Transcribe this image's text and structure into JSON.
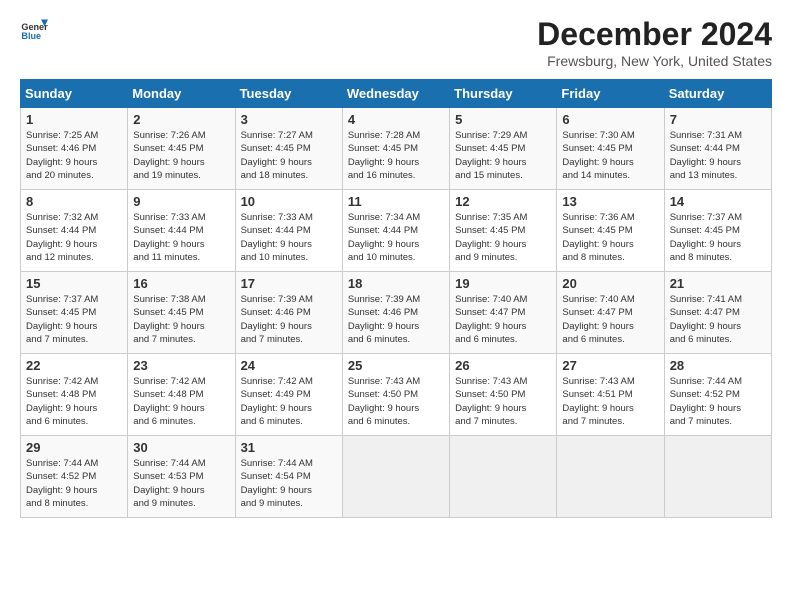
{
  "header": {
    "logo_general": "General",
    "logo_blue": "Blue",
    "title": "December 2024",
    "subtitle": "Frewsburg, New York, United States"
  },
  "days_of_week": [
    "Sunday",
    "Monday",
    "Tuesday",
    "Wednesday",
    "Thursday",
    "Friday",
    "Saturday"
  ],
  "weeks": [
    [
      {
        "day": "1",
        "lines": [
          "Sunrise: 7:25 AM",
          "Sunset: 4:46 PM",
          "Daylight: 9 hours",
          "and 20 minutes."
        ]
      },
      {
        "day": "2",
        "lines": [
          "Sunrise: 7:26 AM",
          "Sunset: 4:45 PM",
          "Daylight: 9 hours",
          "and 19 minutes."
        ]
      },
      {
        "day": "3",
        "lines": [
          "Sunrise: 7:27 AM",
          "Sunset: 4:45 PM",
          "Daylight: 9 hours",
          "and 18 minutes."
        ]
      },
      {
        "day": "4",
        "lines": [
          "Sunrise: 7:28 AM",
          "Sunset: 4:45 PM",
          "Daylight: 9 hours",
          "and 16 minutes."
        ]
      },
      {
        "day": "5",
        "lines": [
          "Sunrise: 7:29 AM",
          "Sunset: 4:45 PM",
          "Daylight: 9 hours",
          "and 15 minutes."
        ]
      },
      {
        "day": "6",
        "lines": [
          "Sunrise: 7:30 AM",
          "Sunset: 4:45 PM",
          "Daylight: 9 hours",
          "and 14 minutes."
        ]
      },
      {
        "day": "7",
        "lines": [
          "Sunrise: 7:31 AM",
          "Sunset: 4:44 PM",
          "Daylight: 9 hours",
          "and 13 minutes."
        ]
      }
    ],
    [
      {
        "day": "8",
        "lines": [
          "Sunrise: 7:32 AM",
          "Sunset: 4:44 PM",
          "Daylight: 9 hours",
          "and 12 minutes."
        ]
      },
      {
        "day": "9",
        "lines": [
          "Sunrise: 7:33 AM",
          "Sunset: 4:44 PM",
          "Daylight: 9 hours",
          "and 11 minutes."
        ]
      },
      {
        "day": "10",
        "lines": [
          "Sunrise: 7:33 AM",
          "Sunset: 4:44 PM",
          "Daylight: 9 hours",
          "and 10 minutes."
        ]
      },
      {
        "day": "11",
        "lines": [
          "Sunrise: 7:34 AM",
          "Sunset: 4:44 PM",
          "Daylight: 9 hours",
          "and 10 minutes."
        ]
      },
      {
        "day": "12",
        "lines": [
          "Sunrise: 7:35 AM",
          "Sunset: 4:45 PM",
          "Daylight: 9 hours",
          "and 9 minutes."
        ]
      },
      {
        "day": "13",
        "lines": [
          "Sunrise: 7:36 AM",
          "Sunset: 4:45 PM",
          "Daylight: 9 hours",
          "and 8 minutes."
        ]
      },
      {
        "day": "14",
        "lines": [
          "Sunrise: 7:37 AM",
          "Sunset: 4:45 PM",
          "Daylight: 9 hours",
          "and 8 minutes."
        ]
      }
    ],
    [
      {
        "day": "15",
        "lines": [
          "Sunrise: 7:37 AM",
          "Sunset: 4:45 PM",
          "Daylight: 9 hours",
          "and 7 minutes."
        ]
      },
      {
        "day": "16",
        "lines": [
          "Sunrise: 7:38 AM",
          "Sunset: 4:45 PM",
          "Daylight: 9 hours",
          "and 7 minutes."
        ]
      },
      {
        "day": "17",
        "lines": [
          "Sunrise: 7:39 AM",
          "Sunset: 4:46 PM",
          "Daylight: 9 hours",
          "and 7 minutes."
        ]
      },
      {
        "day": "18",
        "lines": [
          "Sunrise: 7:39 AM",
          "Sunset: 4:46 PM",
          "Daylight: 9 hours",
          "and 6 minutes."
        ]
      },
      {
        "day": "19",
        "lines": [
          "Sunrise: 7:40 AM",
          "Sunset: 4:47 PM",
          "Daylight: 9 hours",
          "and 6 minutes."
        ]
      },
      {
        "day": "20",
        "lines": [
          "Sunrise: 7:40 AM",
          "Sunset: 4:47 PM",
          "Daylight: 9 hours",
          "and 6 minutes."
        ]
      },
      {
        "day": "21",
        "lines": [
          "Sunrise: 7:41 AM",
          "Sunset: 4:47 PM",
          "Daylight: 9 hours",
          "and 6 minutes."
        ]
      }
    ],
    [
      {
        "day": "22",
        "lines": [
          "Sunrise: 7:42 AM",
          "Sunset: 4:48 PM",
          "Daylight: 9 hours",
          "and 6 minutes."
        ]
      },
      {
        "day": "23",
        "lines": [
          "Sunrise: 7:42 AM",
          "Sunset: 4:48 PM",
          "Daylight: 9 hours",
          "and 6 minutes."
        ]
      },
      {
        "day": "24",
        "lines": [
          "Sunrise: 7:42 AM",
          "Sunset: 4:49 PM",
          "Daylight: 9 hours",
          "and 6 minutes."
        ]
      },
      {
        "day": "25",
        "lines": [
          "Sunrise: 7:43 AM",
          "Sunset: 4:50 PM",
          "Daylight: 9 hours",
          "and 6 minutes."
        ]
      },
      {
        "day": "26",
        "lines": [
          "Sunrise: 7:43 AM",
          "Sunset: 4:50 PM",
          "Daylight: 9 hours",
          "and 7 minutes."
        ]
      },
      {
        "day": "27",
        "lines": [
          "Sunrise: 7:43 AM",
          "Sunset: 4:51 PM",
          "Daylight: 9 hours",
          "and 7 minutes."
        ]
      },
      {
        "day": "28",
        "lines": [
          "Sunrise: 7:44 AM",
          "Sunset: 4:52 PM",
          "Daylight: 9 hours",
          "and 7 minutes."
        ]
      }
    ],
    [
      {
        "day": "29",
        "lines": [
          "Sunrise: 7:44 AM",
          "Sunset: 4:52 PM",
          "Daylight: 9 hours",
          "and 8 minutes."
        ]
      },
      {
        "day": "30",
        "lines": [
          "Sunrise: 7:44 AM",
          "Sunset: 4:53 PM",
          "Daylight: 9 hours",
          "and 9 minutes."
        ]
      },
      {
        "day": "31",
        "lines": [
          "Sunrise: 7:44 AM",
          "Sunset: 4:54 PM",
          "Daylight: 9 hours",
          "and 9 minutes."
        ]
      },
      null,
      null,
      null,
      null
    ]
  ]
}
